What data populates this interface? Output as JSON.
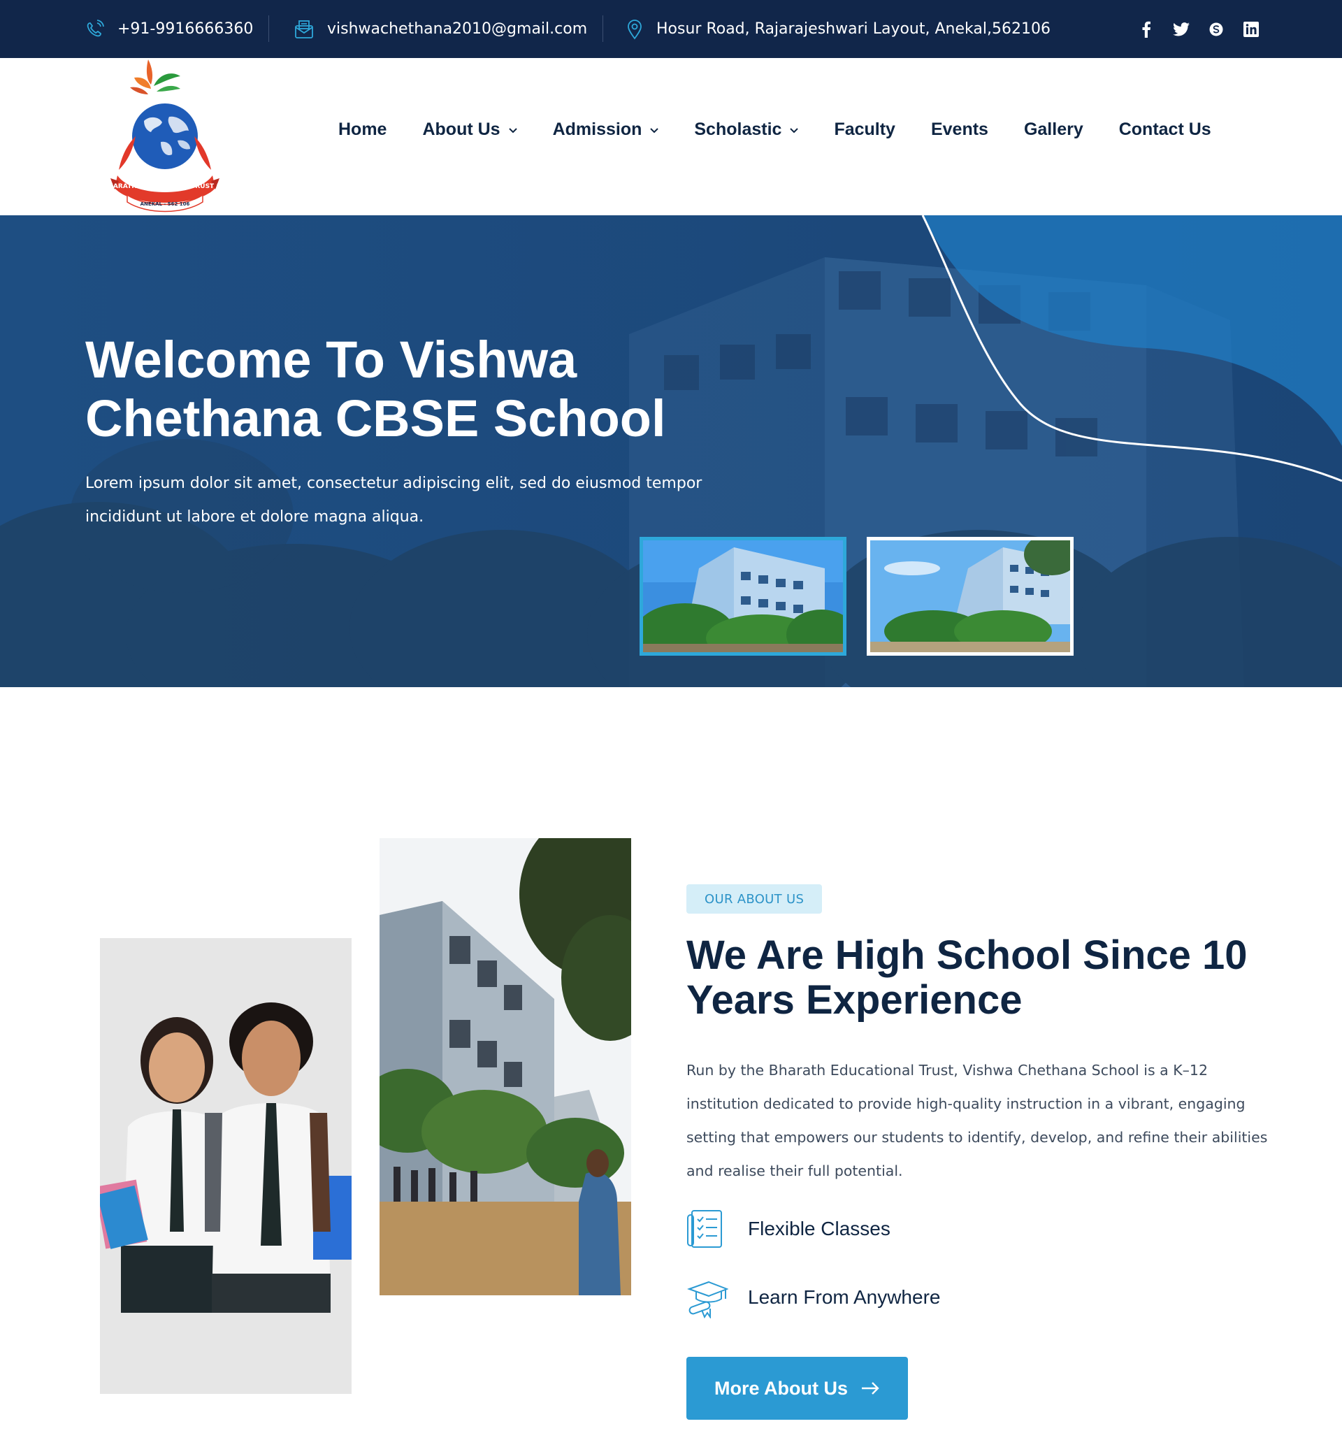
{
  "topbar": {
    "phone": "+91-9916666360",
    "email": "vishwachethana2010@gmail.com",
    "address": "Hosur Road, Rajarajeshwari Layout, Anekal,562106",
    "socials": [
      "facebook-icon",
      "twitter-icon",
      "skype-icon",
      "linkedin-icon"
    ]
  },
  "logo": {
    "arc_text": "BHARATH EDUCATIONAL TRUST (R)",
    "ribbon_text": "ANEKAL - 562 106"
  },
  "nav": {
    "items": [
      {
        "label": "Home",
        "dropdown": false
      },
      {
        "label": "About Us",
        "dropdown": true
      },
      {
        "label": "Admission",
        "dropdown": true
      },
      {
        "label": "Scholastic",
        "dropdown": true
      },
      {
        "label": "Faculty",
        "dropdown": false
      },
      {
        "label": "Events",
        "dropdown": false
      },
      {
        "label": "Gallery",
        "dropdown": false
      },
      {
        "label": "Contact Us",
        "dropdown": false
      }
    ]
  },
  "hero": {
    "title_line1": "Welcome To Vishwa",
    "title_line2": "Chethana CBSE School",
    "subtitle": "Lorem ipsum dolor sit amet, consectetur adipiscing elit, sed do eiusmod tempor incididunt ut labore et dolore magna aliqua."
  },
  "about": {
    "badge": "OUR ABOUT US",
    "title": "We Are High School Since 10 Years Experience",
    "text": "Run by the Bharath Educational Trust, Vishwa Chethana School is a K–12 institution dedicated to provide high-quality instruction in a vibrant, engaging setting that empowers our students to identify, develop, and refine their abilities and realise their full potential.",
    "features": [
      "Flexible Classes",
      "Learn From Anywhere"
    ],
    "button": "More About Us"
  },
  "colors": {
    "topbar": "#11264a",
    "accent": "#2b9ad3",
    "heading": "#0f2542",
    "badge_bg": "#d5eef8"
  }
}
